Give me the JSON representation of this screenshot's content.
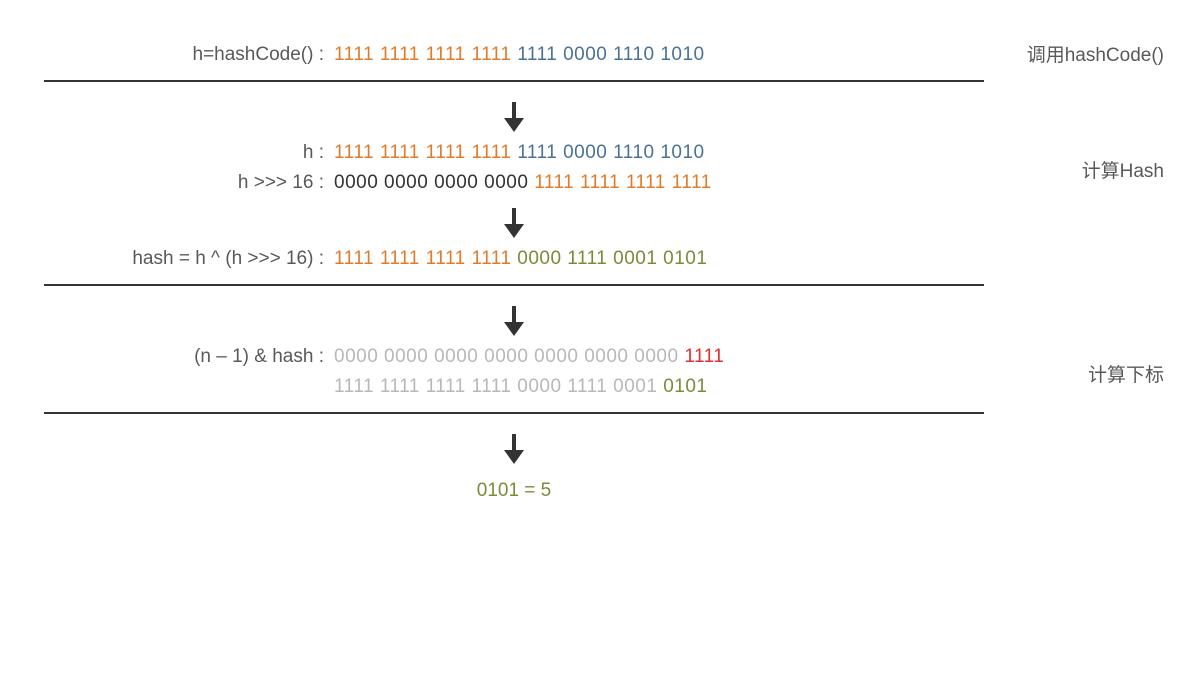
{
  "step1": {
    "label": "h=hashCode() :",
    "bits_hi": "1111 1111 1111 1111 ",
    "bits_lo": "1111 0000 1110 1010",
    "side": "调用hashCode()"
  },
  "step2": {
    "h_label": "h :",
    "h_bits_hi": "1111 1111 1111 1111 ",
    "h_bits_lo": "1111 0000 1110 1010",
    "shift_label": "h >>> 16 :",
    "shift_bits_hi": "0000 0000 0000 0000 ",
    "shift_bits_lo": "1111 1111 1111 1111",
    "side": "计算Hash"
  },
  "step3": {
    "label": "hash = h ^ (h >>> 16) :",
    "bits_hi": "1111 1111 1111 1111 ",
    "bits_lo": "0000 1111 0001 0101"
  },
  "step4": {
    "label": "(n – 1) & hash :",
    "n1_gray": "0000 0000 0000 0000 0000 0000 0000 ",
    "n1_red": "1111",
    "hash_gray": "1111 1111 1111 1111 0000 1111 0001 ",
    "hash_olive": "0101",
    "side": "计算下标"
  },
  "result": "0101 = 5"
}
